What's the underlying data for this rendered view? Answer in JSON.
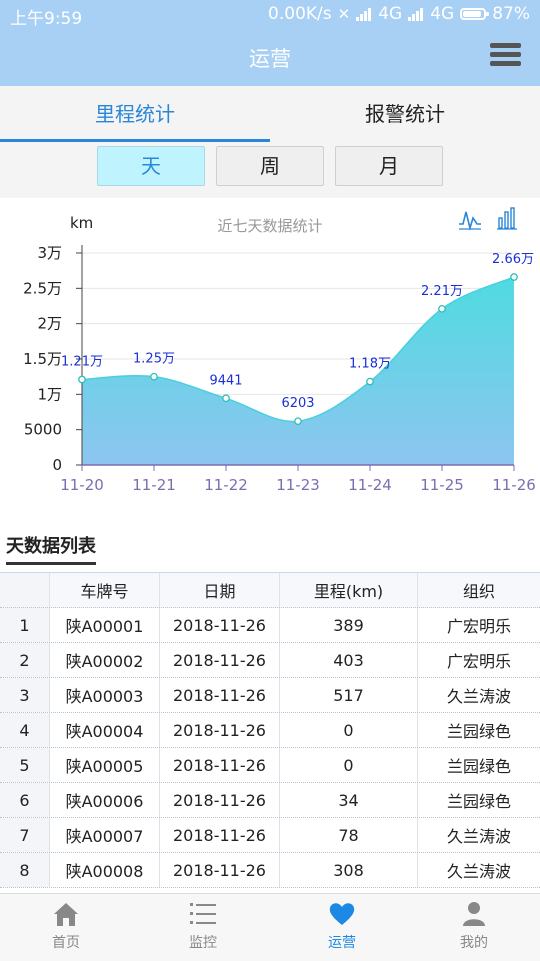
{
  "status_bar": {
    "time": "上午9:59",
    "net_speed": "0.00K/s",
    "net1": "4G",
    "net2": "4G",
    "battery": "87%"
  },
  "header": {
    "title": "运营"
  },
  "tabs": [
    {
      "label": "里程统计",
      "active": true
    },
    {
      "label": "报警统计",
      "active": false
    }
  ],
  "periods": [
    {
      "label": "天",
      "active": true
    },
    {
      "label": "周",
      "active": false
    },
    {
      "label": "月",
      "active": false
    }
  ],
  "chart_icons": {
    "line": "line-chart-icon",
    "bar": "bar-chart-icon"
  },
  "chart_data": {
    "type": "area",
    "title": "近七天数据统计",
    "ylabel": "km",
    "categories": [
      "11-20",
      "11-21",
      "11-22",
      "11-23",
      "11-24",
      "11-25",
      "11-26"
    ],
    "values": [
      12100,
      12500,
      9441,
      6203,
      11800,
      22100,
      26600
    ],
    "data_labels": [
      "1.21万",
      "1.25万",
      "9441",
      "6203",
      "1.18万",
      "2.21万",
      "2.66万"
    ],
    "ylim": [
      0,
      30000
    ],
    "yticks": [
      0,
      5000,
      10000,
      15000,
      20000,
      25000,
      30000
    ],
    "ytick_labels": [
      "0",
      "5000",
      "1万",
      "1.5万",
      "2万",
      "2.5万",
      "3万"
    ],
    "grid": true,
    "colors": {
      "fill_top": "#4fdbe0",
      "fill_bottom": "#8ec5f0",
      "line": "#48cfe0",
      "label": "#1a2fd8",
      "axis": "#7a6fb0"
    }
  },
  "table": {
    "title": "天数据列表",
    "columns": [
      "",
      "车牌号",
      "日期",
      "里程(km)",
      "组织"
    ],
    "rows": [
      [
        "1",
        "陕A00001",
        "2018-11-26",
        "389",
        "广宏明乐"
      ],
      [
        "2",
        "陕A00002",
        "2018-11-26",
        "403",
        "广宏明乐"
      ],
      [
        "3",
        "陕A00003",
        "2018-11-26",
        "517",
        "久兰涛波"
      ],
      [
        "4",
        "陕A00004",
        "2018-11-26",
        "0",
        "兰园绿色"
      ],
      [
        "5",
        "陕A00005",
        "2018-11-26",
        "0",
        "兰园绿色"
      ],
      [
        "6",
        "陕A00006",
        "2018-11-26",
        "34",
        "兰园绿色"
      ],
      [
        "7",
        "陕A00007",
        "2018-11-26",
        "78",
        "久兰涛波"
      ],
      [
        "8",
        "陕A00008",
        "2018-11-26",
        "308",
        "久兰涛波"
      ]
    ]
  },
  "bottom_nav": [
    {
      "label": "首页",
      "icon": "home-icon",
      "active": false
    },
    {
      "label": "监控",
      "icon": "list-icon",
      "active": false
    },
    {
      "label": "运营",
      "icon": "heart-icon",
      "active": true
    },
    {
      "label": "我的",
      "icon": "user-icon",
      "active": false
    }
  ]
}
